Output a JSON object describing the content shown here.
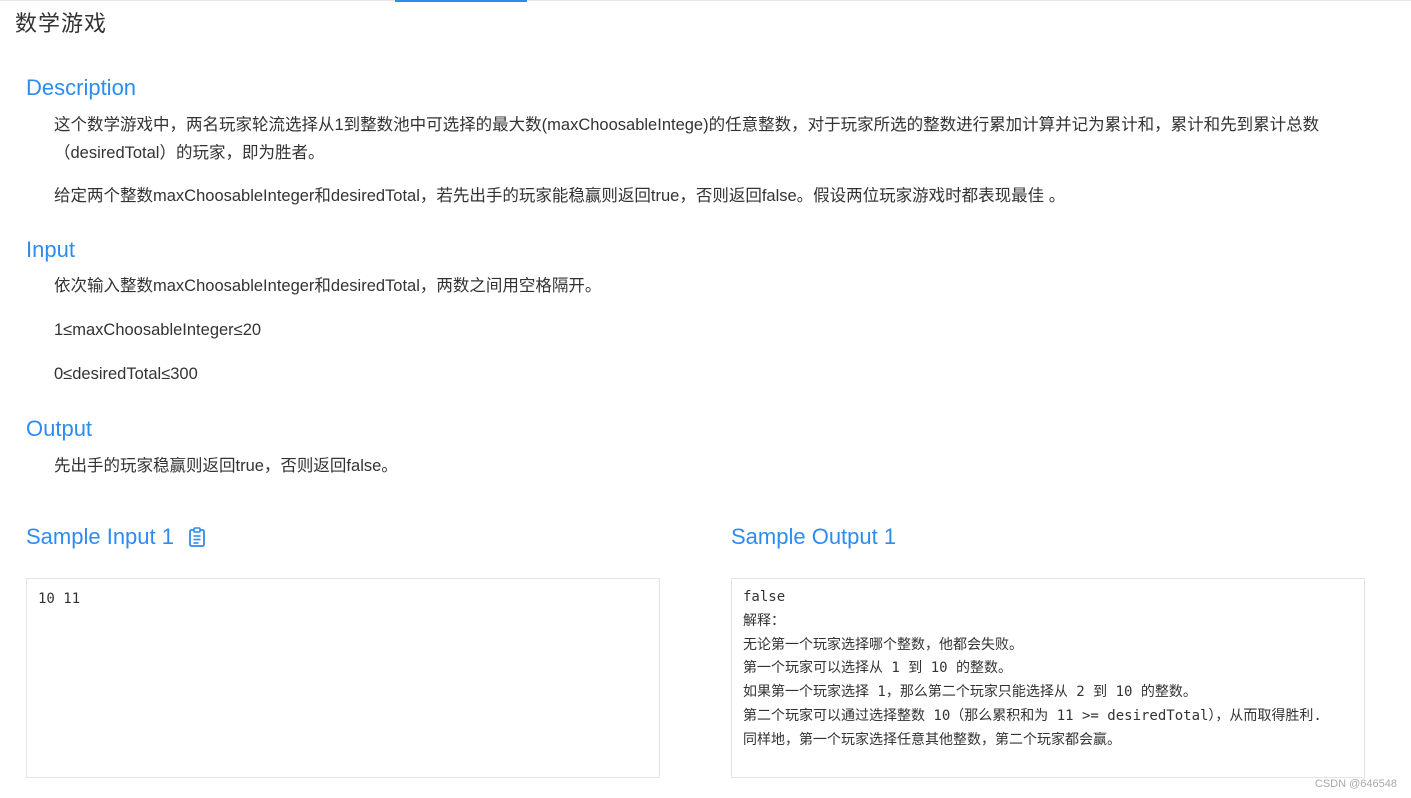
{
  "page": {
    "title": "数学游戏"
  },
  "description": {
    "heading": "Description",
    "para1": "这个数学游戏中，两名玩家轮流选择从1到整数池中可选择的最大数(maxChoosableIntege)的任意整数，对于玩家所选的整数进行累加计算并记为累计和，累计和先到累计总数（desiredTotal）的玩家，即为胜者。",
    "para2": "给定两个整数maxChoosableInteger和desiredTotal，若先出手的玩家能稳赢则返回true，否则返回false。假设两位玩家游戏时都表现最佳 。"
  },
  "input": {
    "heading": "Input",
    "line1": "依次输入整数maxChoosableInteger和desiredTotal，两数之间用空格隔开。",
    "line2": "1≤maxChoosableInteger≤20",
    "line3": "0≤desiredTotal≤300"
  },
  "output": {
    "heading": "Output",
    "line1": "先出手的玩家稳赢则返回true，否则返回false。"
  },
  "sample_input": {
    "heading": "Sample Input 1",
    "copy_icon": "clipboard-icon",
    "content": "10 11"
  },
  "sample_output": {
    "heading": "Sample Output 1",
    "content": "false\n解释：\n无论第一个玩家选择哪个整数，他都会失败。\n第一个玩家可以选择从 1 到 10 的整数。\n如果第一个玩家选择 1，那么第二个玩家只能选择从 2 到 10 的整数。\n第二个玩家可以通过选择整数 10（那么累积和为 11 >= desiredTotal），从而取得胜利.\n同样地，第一个玩家选择任意其他整数，第二个玩家都会赢。"
  },
  "watermark": "CSDN @646548",
  "colors": {
    "accent": "#2d8cf0",
    "text": "#333333",
    "border": "#e4e4e4"
  }
}
